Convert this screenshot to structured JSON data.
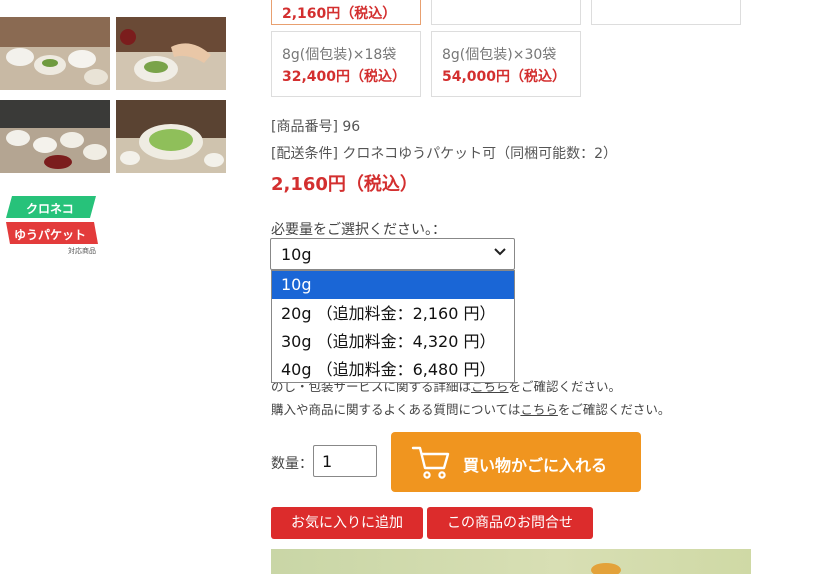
{
  "options_cards": [
    {
      "line1": "",
      "price": "2,160円（税込）",
      "selected": true
    },
    {
      "line1": "",
      "price": "",
      "selected": false
    },
    {
      "line1": "",
      "price": "",
      "selected": false
    },
    {
      "line1": "8g(個包装)×18袋",
      "price": "32,400円（税込）",
      "selected": false
    },
    {
      "line1": "8g(個包装)×30袋",
      "price": "54,000円（税込）",
      "selected": false
    }
  ],
  "product": {
    "number_label": "[商品番号] 96",
    "shipping_label": "[配送条件] クロネコゆうパケット可（同梱可能数：2）",
    "price": "2,160円（税込）"
  },
  "badge": {
    "top": "クロネコ",
    "bottom": "ゆうパケット",
    "small": "対応商品"
  },
  "amount_select": {
    "label": "必要量をご選択ください。：",
    "value": "10g",
    "options": [
      "10g",
      "20g （追加料金：2,160 円）",
      "30g （追加料金：4,320 円）",
      "40g （追加料金：6,480 円）"
    ]
  },
  "notes": {
    "wrap_prefix": "のし・包装サービスに関する詳細は",
    "wrap_link": "こちら",
    "wrap_suffix": "をご確認ください。",
    "faq_prefix": "購入や商品に関するよくある質問については",
    "faq_link": "こちら",
    "faq_suffix": "をご確認ください。"
  },
  "quantity": {
    "label": "数量：",
    "value": "1"
  },
  "buttons": {
    "add_to_cart": "買い物かごに入れる",
    "favorite": "お気に入りに追加",
    "inquiry": "この商品のお問合せ"
  },
  "colors": {
    "accent_red": "#d32f2f",
    "cart_orange": "#f0951f",
    "button_red": "#dc2c2c",
    "dropdown_highlight": "#1a66d6"
  }
}
